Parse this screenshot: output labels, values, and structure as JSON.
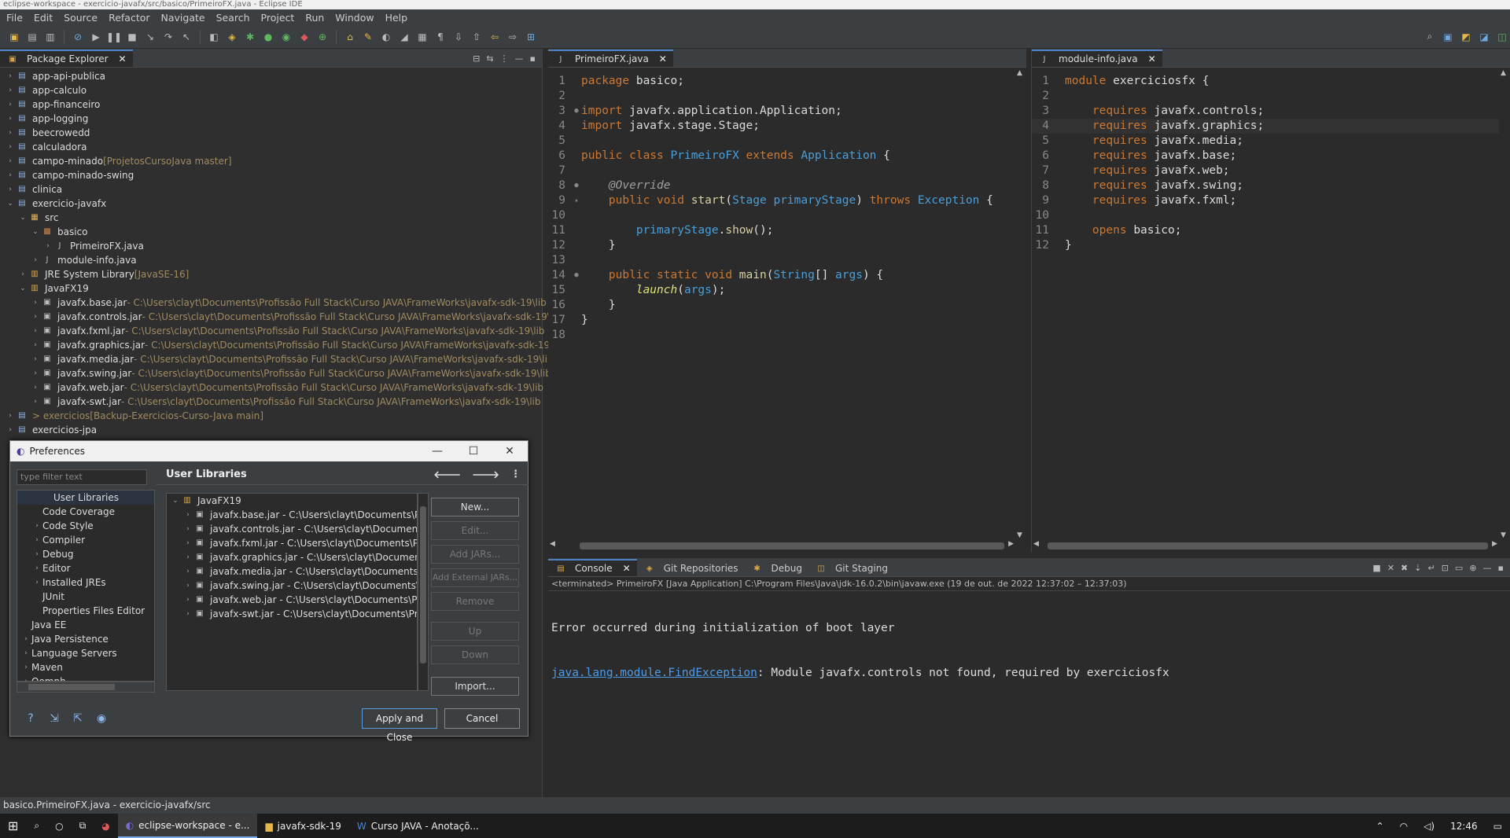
{
  "window": {
    "title": "eclipse-workspace - exercicio-javafx/src/basico/PrimeiroFX.java - Eclipse IDE"
  },
  "menu": [
    "File",
    "Edit",
    "Source",
    "Refactor",
    "Navigate",
    "Search",
    "Project",
    "Run",
    "Window",
    "Help"
  ],
  "package_explorer": {
    "tab_label": "Package Explorer",
    "rows": [
      {
        "name": "app-api-publica",
        "dec": "",
        "depth": 0,
        "kind": "proj",
        "tw": "›"
      },
      {
        "name": "app-calculo",
        "dec": "",
        "depth": 0,
        "kind": "proj",
        "tw": "›"
      },
      {
        "name": "app-financeiro",
        "dec": "",
        "depth": 0,
        "kind": "proj",
        "tw": "›"
      },
      {
        "name": "app-logging",
        "dec": "",
        "depth": 0,
        "kind": "proj",
        "tw": "›"
      },
      {
        "name": "beecrowedd",
        "dec": "",
        "depth": 0,
        "kind": "proj",
        "tw": "›"
      },
      {
        "name": "calculadora",
        "dec": "",
        "depth": 0,
        "kind": "proj",
        "tw": "›"
      },
      {
        "name": "campo-minado",
        "dec": " [ProjetosCursoJava master]",
        "depth": 0,
        "kind": "proj",
        "tw": "›"
      },
      {
        "name": "campo-minado-swing",
        "dec": "",
        "depth": 0,
        "kind": "proj",
        "tw": "›"
      },
      {
        "name": "clinica",
        "dec": "",
        "depth": 0,
        "kind": "proj",
        "tw": "›"
      },
      {
        "name": "exercicio-javafx",
        "dec": "",
        "depth": 0,
        "kind": "proj",
        "tw": "⌄"
      },
      {
        "name": "src",
        "dec": "",
        "depth": 1,
        "kind": "fold",
        "tw": "⌄"
      },
      {
        "name": "basico",
        "dec": "",
        "depth": 2,
        "kind": "pkg",
        "tw": "⌄"
      },
      {
        "name": "PrimeiroFX.java",
        "dec": "",
        "depth": 3,
        "kind": "java",
        "tw": "›"
      },
      {
        "name": "module-info.java",
        "dec": "",
        "depth": 2,
        "kind": "java",
        "tw": "›"
      },
      {
        "name": "JRE System Library",
        "dec": " [JavaSE-16]",
        "depth": 1,
        "kind": "lib",
        "tw": "›"
      },
      {
        "name": "JavaFX19",
        "dec": "",
        "depth": 1,
        "kind": "lib",
        "tw": "⌄"
      },
      {
        "name": "javafx.base.jar",
        "dec": " - C:\\Users\\clayt\\Documents\\Profissão Full Stack\\Curso JAVA\\FrameWorks\\javafx-sdk-19\\lib",
        "depth": 2,
        "kind": "jar",
        "tw": "›"
      },
      {
        "name": "javafx.controls.jar",
        "dec": " - C:\\Users\\clayt\\Documents\\Profissão Full Stack\\Curso JAVA\\FrameWorks\\javafx-sdk-19\\lib",
        "depth": 2,
        "kind": "jar",
        "tw": "›"
      },
      {
        "name": "javafx.fxml.jar",
        "dec": " - C:\\Users\\clayt\\Documents\\Profissão Full Stack\\Curso JAVA\\FrameWorks\\javafx-sdk-19\\lib",
        "depth": 2,
        "kind": "jar",
        "tw": "›"
      },
      {
        "name": "javafx.graphics.jar",
        "dec": " - C:\\Users\\clayt\\Documents\\Profissão Full Stack\\Curso JAVA\\FrameWorks\\javafx-sdk-19\\lib",
        "depth": 2,
        "kind": "jar",
        "tw": "›"
      },
      {
        "name": "javafx.media.jar",
        "dec": " - C:\\Users\\clayt\\Documents\\Profissão Full Stack\\Curso JAVA\\FrameWorks\\javafx-sdk-19\\lib",
        "depth": 2,
        "kind": "jar",
        "tw": "›"
      },
      {
        "name": "javafx.swing.jar",
        "dec": " - C:\\Users\\clayt\\Documents\\Profissão Full Stack\\Curso JAVA\\FrameWorks\\javafx-sdk-19\\lib",
        "depth": 2,
        "kind": "jar",
        "tw": "›"
      },
      {
        "name": "javafx.web.jar",
        "dec": " - C:\\Users\\clayt\\Documents\\Profissão Full Stack\\Curso JAVA\\FrameWorks\\javafx-sdk-19\\lib",
        "depth": 2,
        "kind": "jar",
        "tw": "›"
      },
      {
        "name": "javafx-swt.jar",
        "dec": " - C:\\Users\\clayt\\Documents\\Profissão Full Stack\\Curso JAVA\\FrameWorks\\javafx-sdk-19\\lib",
        "depth": 2,
        "kind": "jar",
        "tw": "›"
      },
      {
        "name": "> exercicios",
        "dec": " [Backup-Exercicios-Curso-Java main]",
        "depth": 0,
        "kind": "proj",
        "tw": "›",
        "git": true
      },
      {
        "name": "exercicios-jpa",
        "dec": "",
        "depth": 0,
        "kind": "proj",
        "tw": "›"
      }
    ]
  },
  "editor1": {
    "tab_label": "PrimeiroFX.java",
    "lines": [
      [
        [
          "kw",
          "package "
        ],
        [
          "pl",
          "basico;"
        ]
      ],
      [],
      [
        [
          "kw",
          "import "
        ],
        [
          "pl",
          "javafx.application.Application;"
        ]
      ],
      [
        [
          "kw",
          "import "
        ],
        [
          "pl",
          "javafx.stage.Stage;"
        ]
      ],
      [],
      [
        [
          "kw",
          "public class "
        ],
        [
          "cls",
          "PrimeiroFX "
        ],
        [
          "kw",
          "extends "
        ],
        [
          "cls",
          "Application "
        ],
        [
          "pl",
          "{"
        ]
      ],
      [],
      [
        [
          "pl",
          "    "
        ],
        [
          "ann",
          "@Override"
        ]
      ],
      [
        [
          "pl",
          "    "
        ],
        [
          "kw",
          "public void "
        ],
        [
          "fn",
          "start"
        ],
        [
          "pl",
          "("
        ],
        [
          "cls",
          "Stage "
        ],
        [
          "ty",
          "primaryStage"
        ],
        [
          "pl",
          ") "
        ],
        [
          "kw",
          "throws "
        ],
        [
          "cls",
          "Exception "
        ],
        [
          "pl",
          "{"
        ]
      ],
      [],
      [
        [
          "pl",
          "        "
        ],
        [
          "ty",
          "primaryStage"
        ],
        [
          "pl",
          "."
        ],
        [
          "fn",
          "show"
        ],
        [
          "pl",
          "();"
        ]
      ],
      [
        [
          "pl",
          "    }"
        ]
      ],
      [],
      [
        [
          "pl",
          "    "
        ],
        [
          "kw",
          "public static void "
        ],
        [
          "fn",
          "main"
        ],
        [
          "pl",
          "("
        ],
        [
          "cls",
          "String"
        ],
        [
          "pl",
          "[] "
        ],
        [
          "ty",
          "args"
        ],
        [
          "pl",
          ") {"
        ]
      ],
      [
        [
          "pl",
          "        "
        ],
        [
          "it",
          "launch"
        ],
        [
          "pl",
          "("
        ],
        [
          "ty",
          "args"
        ],
        [
          "pl",
          ");"
        ]
      ],
      [
        [
          "pl",
          "    }"
        ]
      ],
      [
        [
          "pl",
          "}"
        ]
      ],
      []
    ]
  },
  "editor2": {
    "tab_label": "module-info.java",
    "lines": [
      [
        [
          "kw",
          "module "
        ],
        [
          "pl",
          "exerciciosfx {"
        ]
      ],
      [],
      [
        [
          "pl",
          "    "
        ],
        [
          "kw",
          "requires "
        ],
        [
          "pl",
          "javafx.controls;"
        ]
      ],
      [
        [
          "pl",
          "    "
        ],
        [
          "kw",
          "requires "
        ],
        [
          "pl",
          "javafx.graphics;"
        ]
      ],
      [
        [
          "pl",
          "    "
        ],
        [
          "kw",
          "requires "
        ],
        [
          "pl",
          "javafx.media;"
        ]
      ],
      [
        [
          "pl",
          "    "
        ],
        [
          "kw",
          "requires "
        ],
        [
          "pl",
          "javafx.base;"
        ]
      ],
      [
        [
          "pl",
          "    "
        ],
        [
          "kw",
          "requires "
        ],
        [
          "pl",
          "javafx.web;"
        ]
      ],
      [
        [
          "pl",
          "    "
        ],
        [
          "kw",
          "requires "
        ],
        [
          "pl",
          "javafx.swing;"
        ]
      ],
      [
        [
          "pl",
          "    "
        ],
        [
          "kw",
          "requires "
        ],
        [
          "pl",
          "javafx.fxml;"
        ]
      ],
      [],
      [
        [
          "pl",
          "    "
        ],
        [
          "kw",
          "opens "
        ],
        [
          "pl",
          "basico;"
        ]
      ],
      [
        [
          "pl",
          "}"
        ]
      ]
    ]
  },
  "console": {
    "tabs": [
      "Console",
      "Git Repositories",
      "Debug",
      "Git Staging"
    ],
    "terminated": "<terminated> PrimeiroFX [Java Application] C:\\Program Files\\Java\\jdk-16.0.2\\bin\\javaw.exe  (19 de out. de 2022 12:37:02 – 12:37:03)",
    "line1": "Error occurred during initialization of boot layer",
    "exception": "java.lang.module.FindException",
    "line2_rest": ": Module javafx.controls not found, required by exerciciosfx"
  },
  "preferences": {
    "title": "Preferences",
    "filter_placeholder": "type filter text",
    "nav": [
      {
        "label": "User Libraries",
        "depth": 2,
        "tw": ""
      },
      {
        "label": "Code Coverage",
        "depth": 1,
        "tw": ""
      },
      {
        "label": "Code Style",
        "depth": 1,
        "tw": "›"
      },
      {
        "label": "Compiler",
        "depth": 1,
        "tw": "›"
      },
      {
        "label": "Debug",
        "depth": 1,
        "tw": "›"
      },
      {
        "label": "Editor",
        "depth": 1,
        "tw": "›"
      },
      {
        "label": "Installed JREs",
        "depth": 1,
        "tw": "›"
      },
      {
        "label": "JUnit",
        "depth": 1,
        "tw": ""
      },
      {
        "label": "Properties Files Editor",
        "depth": 1,
        "tw": ""
      },
      {
        "label": "Java EE",
        "depth": 0,
        "tw": ""
      },
      {
        "label": "Java Persistence",
        "depth": 0,
        "tw": "›"
      },
      {
        "label": "Language Servers",
        "depth": 0,
        "tw": "›"
      },
      {
        "label": "Maven",
        "depth": 0,
        "tw": "›"
      },
      {
        "label": "Oomph",
        "depth": 0,
        "tw": "›"
      }
    ],
    "page_title": "User Libraries",
    "library": "JavaFX19",
    "jars": [
      "javafx.base.jar - C:\\Users\\clayt\\Documents\\Profiss",
      "javafx.controls.jar - C:\\Users\\clayt\\Documents\\Pro",
      "javafx.fxml.jar - C:\\Users\\clayt\\Documents\\Profiss",
      "javafx.graphics.jar - C:\\Users\\clayt\\Documents\\Pr",
      "javafx.media.jar - C:\\Users\\clayt\\Documents\\Profi",
      "javafx.swing.jar - C:\\Users\\clayt\\Documents\\Profis",
      "javafx.web.jar - C:\\Users\\clayt\\Documents\\Profissa",
      "javafx-swt.jar - C:\\Users\\clayt\\Documents\\Profissã"
    ],
    "buttons": {
      "new": "New...",
      "edit": "Edit...",
      "add_jars": "Add JARs...",
      "add_external": "Add External JARs...",
      "remove": "Remove",
      "up": "Up",
      "down": "Down",
      "import": "Import..."
    },
    "apply_close": "Apply and Close",
    "cancel": "Cancel"
  },
  "status": "basico.PrimeiroFX.java - exercicio-javafx/src",
  "taskbar": {
    "items": [
      "eclipse-workspace - e...",
      "javafx-sdk-19",
      "Curso JAVA - Anotaçõ..."
    ],
    "time": "12:46"
  },
  "colors": {
    "keyword": "#cc7832",
    "type": "#4a9fd8",
    "accent": "#4c83c4"
  }
}
